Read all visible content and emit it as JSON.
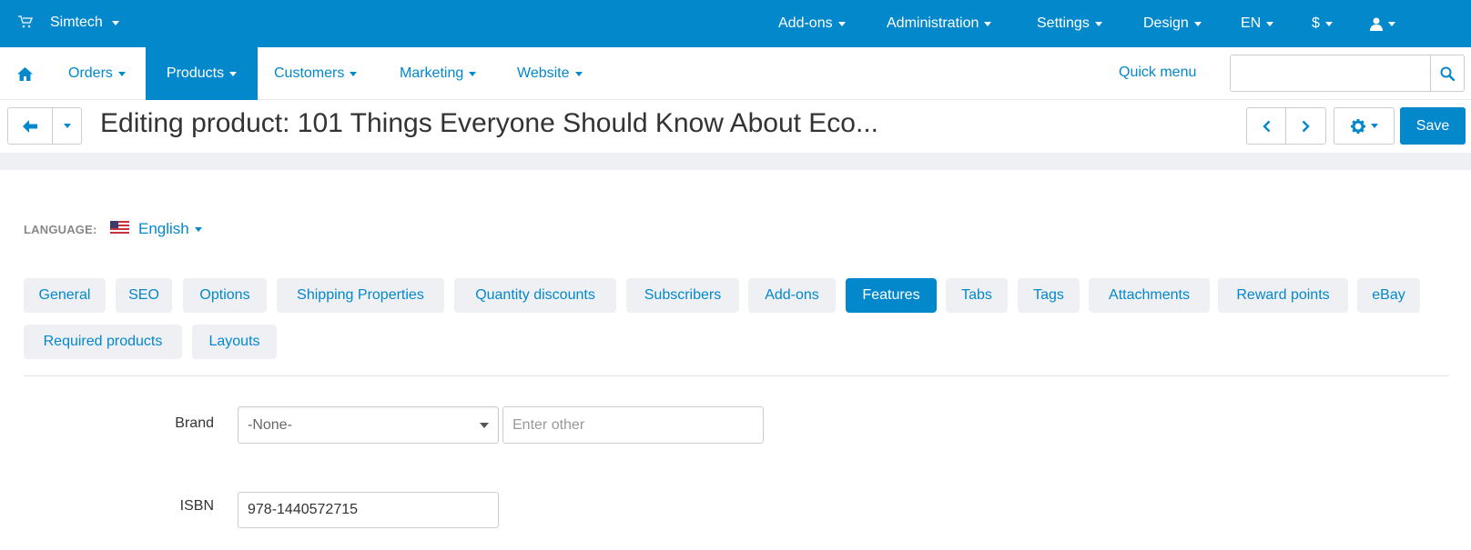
{
  "topbar": {
    "brand": "Simtech",
    "menus": [
      "Add-ons",
      "Administration",
      "Settings",
      "Design",
      "EN",
      "$"
    ]
  },
  "nav": {
    "items": [
      "Orders",
      "Products",
      "Customers",
      "Marketing",
      "Website"
    ],
    "active": "Products",
    "quick_menu": "Quick menu",
    "search_placeholder": ""
  },
  "header": {
    "title": "Editing product: 101 Things Everyone Should Know About Eco...",
    "save_label": "Save"
  },
  "language": {
    "label": "LANGUAGE:",
    "value": "English"
  },
  "tabs": [
    "General",
    "SEO",
    "Options",
    "Shipping Properties",
    "Quantity discounts",
    "Subscribers",
    "Add-ons",
    "Features",
    "Tabs",
    "Tags",
    "Attachments",
    "Reward points",
    "eBay",
    "Required products",
    "Layouts"
  ],
  "active_tab": "Features",
  "form": {
    "brand_label": "Brand",
    "brand_value": "-None-",
    "brand_other_placeholder": "Enter other",
    "isbn_label": "ISBN",
    "isbn_value": "978-1440572715"
  },
  "colors": {
    "accent": "#0388cc",
    "tab_bg": "#eef0f3"
  }
}
